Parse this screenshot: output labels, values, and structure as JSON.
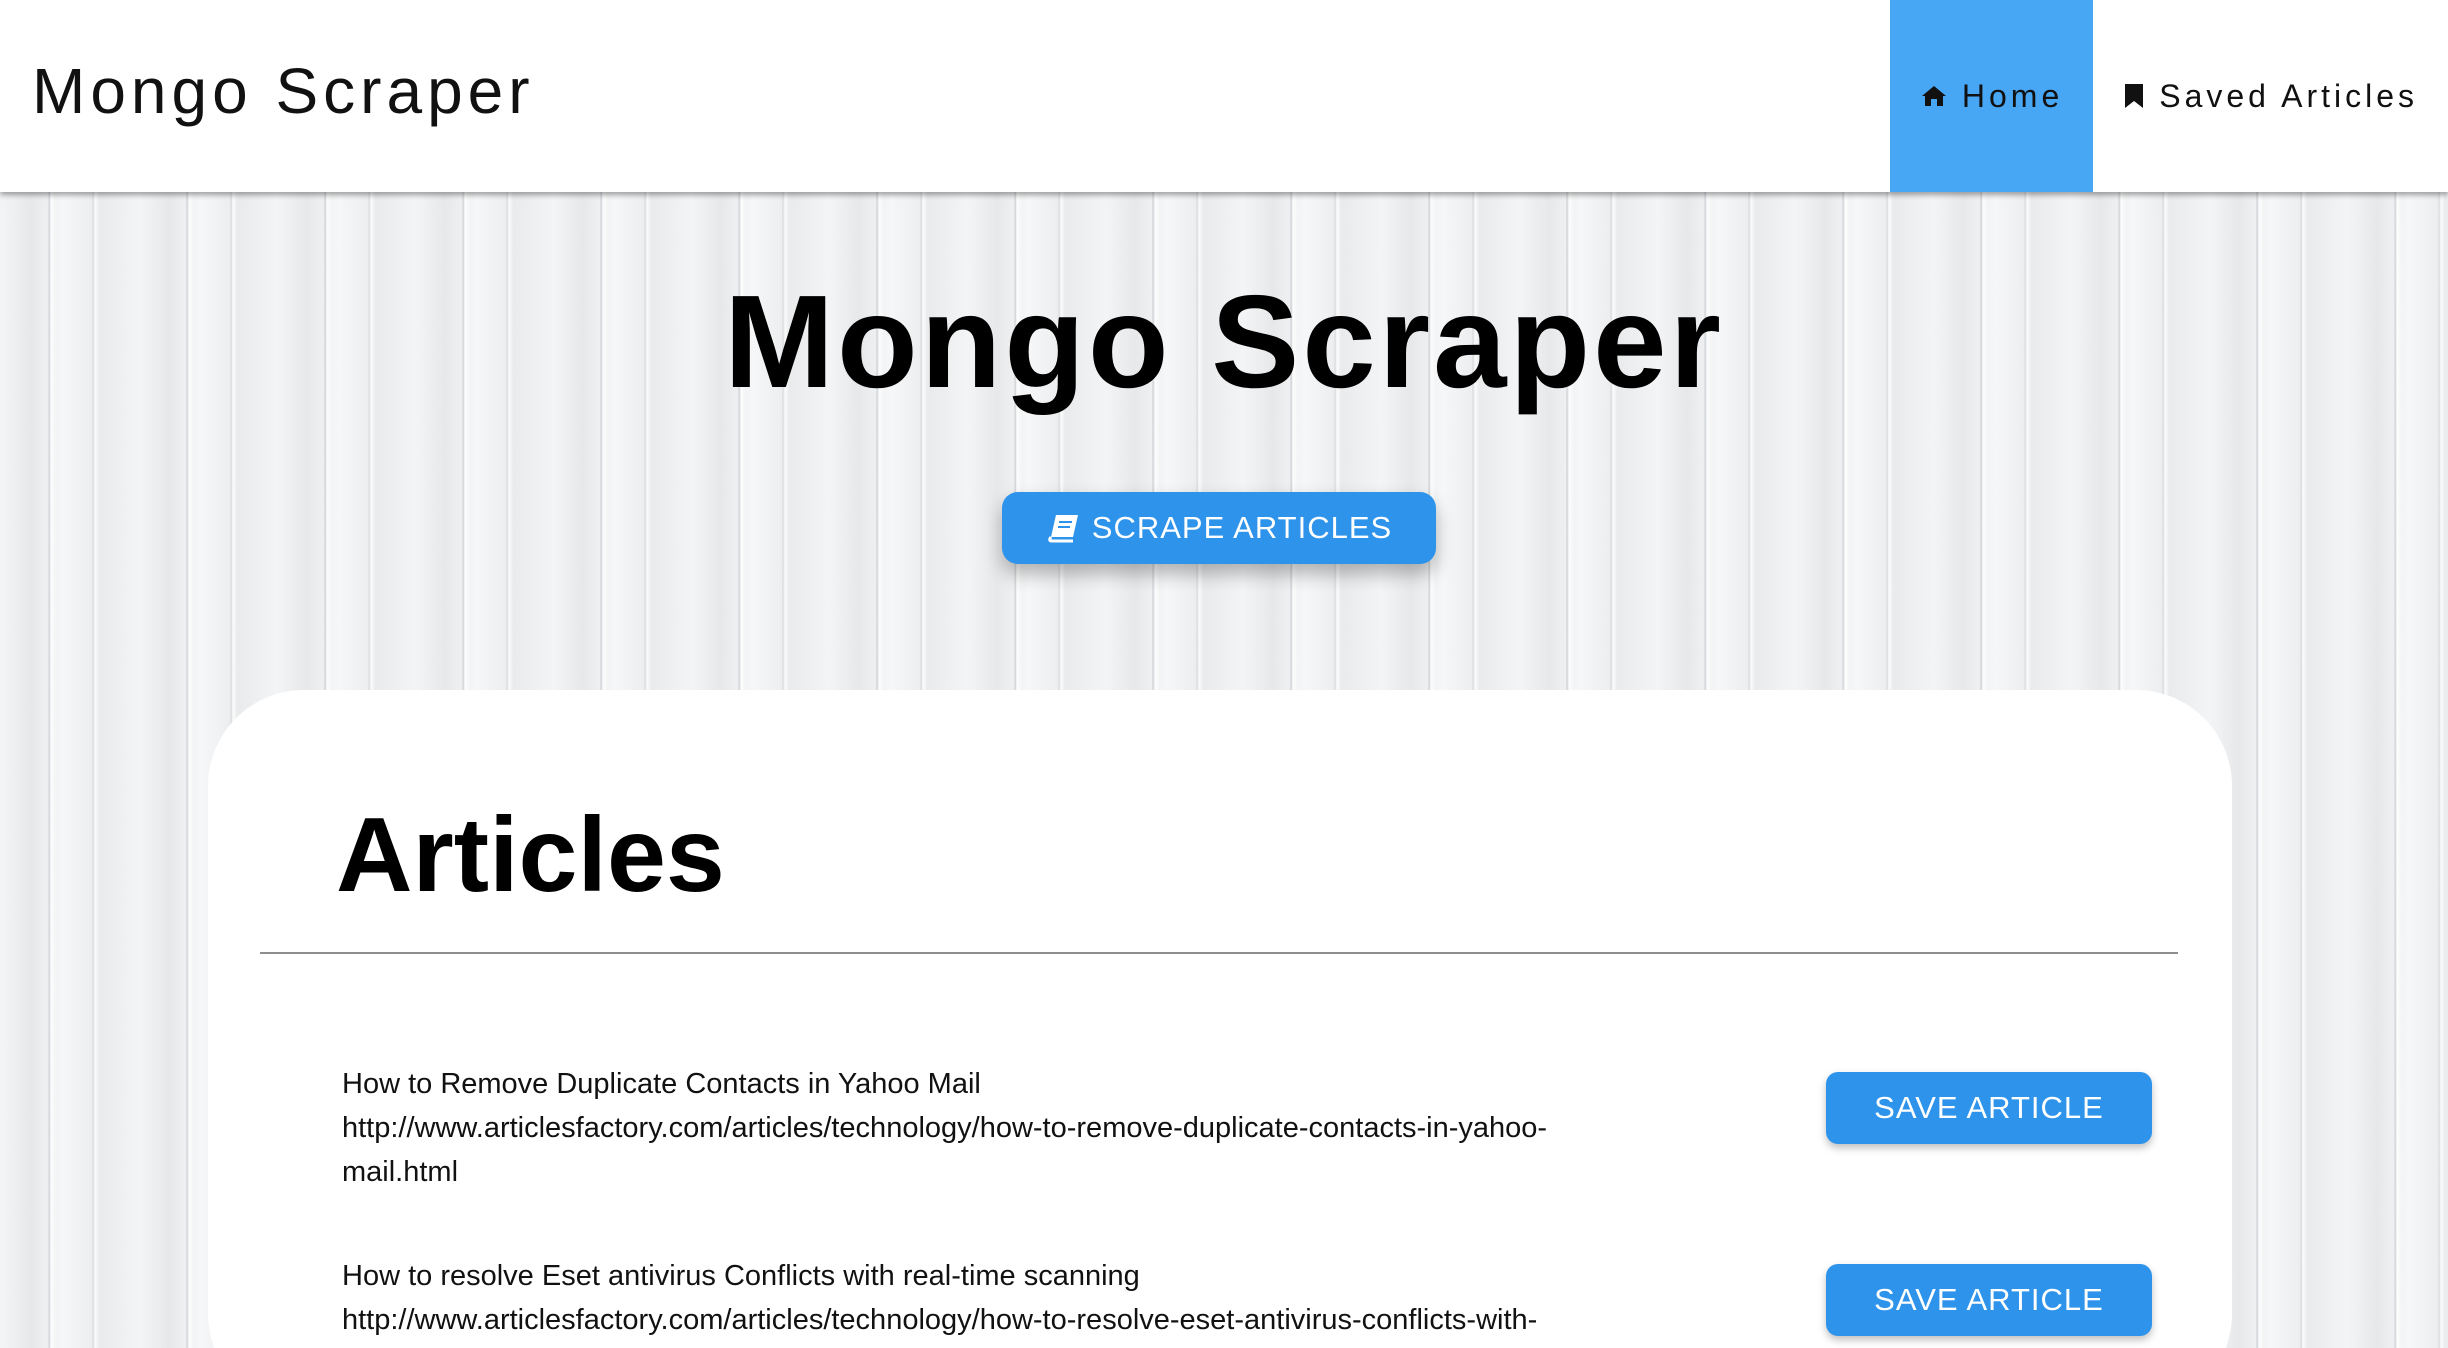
{
  "navbar": {
    "brand": "Mongo Scraper",
    "links": [
      {
        "label": "Home",
        "icon": "home-icon",
        "active": true
      },
      {
        "label": "Saved Articles",
        "icon": "bookmark-icon",
        "active": false
      }
    ]
  },
  "hero": {
    "title": "Mongo Scraper",
    "scrape_button": {
      "label": "SCRAPE ARTICLES",
      "icon": "book-icon"
    }
  },
  "articles_section": {
    "title": "Articles",
    "items": [
      {
        "title": "How to Remove Duplicate Contacts in Yahoo Mail",
        "url_line1": "http://www.articlesfactory.com/articles/technology/how-to-remove-duplicate-contacts-in-yahoo-",
        "url_line2": "mail.html",
        "button": "SAVE ARTICLE"
      },
      {
        "title": "How to resolve Eset antivirus Conflicts with real-time scanning",
        "url_line1": "http://www.articlesfactory.com/articles/technology/how-to-resolve-eset-antivirus-conflicts-with-",
        "url_line2": "",
        "button": "SAVE ARTICLE"
      }
    ]
  },
  "colors": {
    "accent": "#47a7f5",
    "button": "#2e93ea",
    "panel": "#ffffff"
  }
}
